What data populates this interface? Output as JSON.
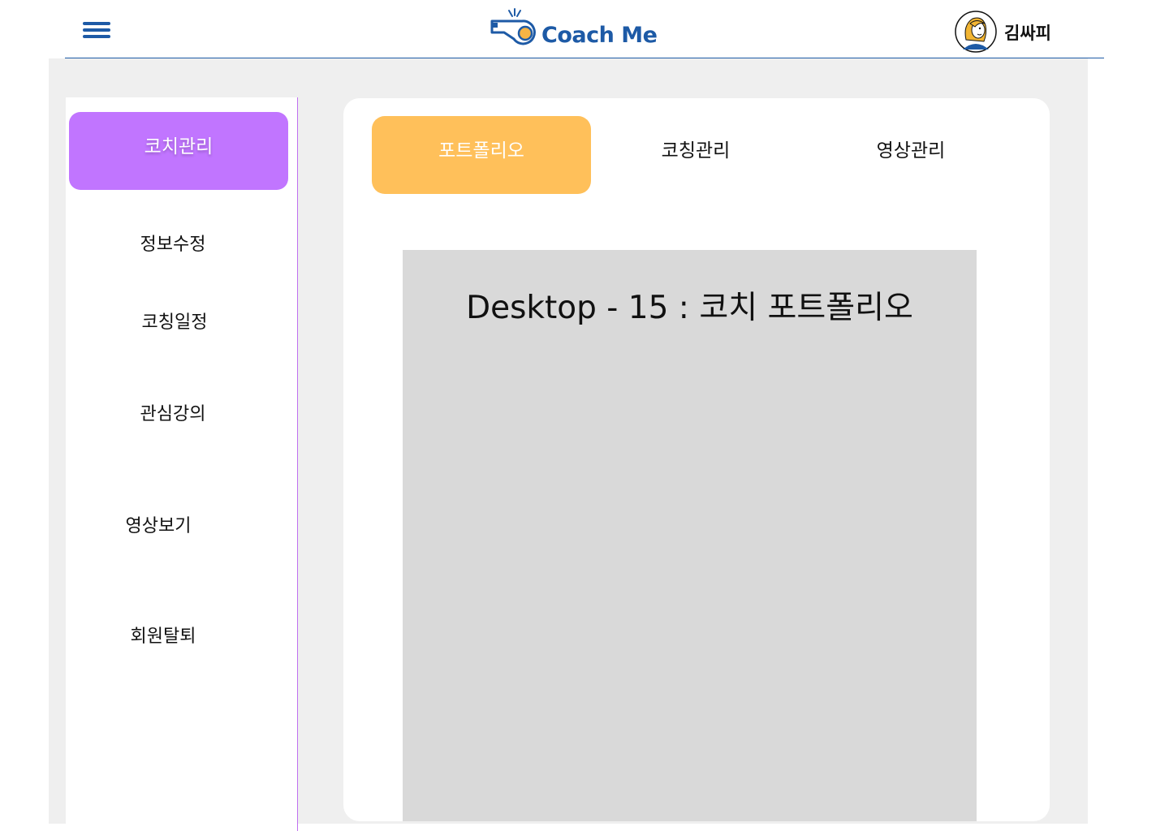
{
  "header": {
    "menu_icon": "hamburger-menu-icon",
    "logo_text": "Coach Me",
    "logo_icon": "whistle-icon",
    "user_name": "김싸피",
    "brand_color": "#1d5aa6"
  },
  "sidebar": {
    "active_label": "코치관리",
    "items": [
      {
        "label": "정보수정"
      },
      {
        "label": "코칭일정"
      },
      {
        "label": "관심강의"
      },
      {
        "label": "영상보기"
      },
      {
        "label": "회원탈퇴"
      }
    ],
    "accent_color": "#c175ff"
  },
  "tabs": [
    {
      "label": "포트폴리오",
      "active": true
    },
    {
      "label": "코칭관리",
      "active": false
    },
    {
      "label": "영상관리",
      "active": false
    }
  ],
  "tab_active_color": "#ffc05a",
  "content": {
    "placeholder_text": "Desktop - 15 : 코치 포트폴리오"
  }
}
